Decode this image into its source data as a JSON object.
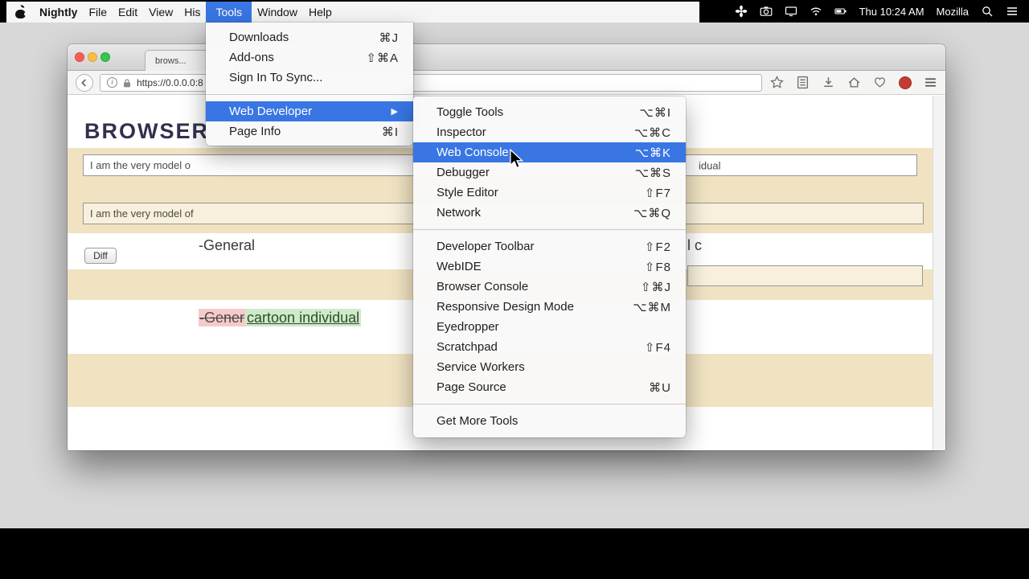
{
  "menubar": {
    "items": [
      "Nightly",
      "File",
      "Edit",
      "View",
      "His",
      "Tools",
      "Window",
      "Help"
    ],
    "selected_item": "Tools",
    "status": {
      "time": "Thu 10:24 AM",
      "label": "Mozilla"
    }
  },
  "tools_menu": {
    "submenu_arrow": "▶",
    "items": [
      {
        "label": "Downloads",
        "shortcut": "⌘J"
      },
      {
        "label": "Add-ons",
        "shortcut": "⇧⌘A"
      },
      {
        "label": "Sign In To Sync...",
        "shortcut": ""
      },
      {
        "separator": true
      },
      {
        "label": "Web Developer",
        "shortcut": "",
        "submenu": true,
        "highlighted": true
      },
      {
        "label": "Page Info",
        "shortcut": "⌘I"
      }
    ]
  },
  "webdev_menu": {
    "items": [
      {
        "label": "Toggle Tools",
        "shortcut": "⌥⌘I"
      },
      {
        "label": "Inspector",
        "shortcut": "⌥⌘C"
      },
      {
        "label": "Web Console",
        "shortcut": "⌥⌘K",
        "highlighted": true
      },
      {
        "label": "Debugger",
        "shortcut": "⌥⌘S"
      },
      {
        "label": "Style Editor",
        "shortcut": "⇧F7"
      },
      {
        "label": "Network",
        "shortcut": "⌥⌘Q"
      },
      {
        "separator": true
      },
      {
        "label": "Developer Toolbar",
        "shortcut": "⇧F2"
      },
      {
        "label": "WebIDE",
        "shortcut": "⇧F8"
      },
      {
        "label": "Browser Console",
        "shortcut": "⇧⌘J"
      },
      {
        "label": "Responsive Design Mode",
        "shortcut": "⌥⌘M"
      },
      {
        "label": "Eyedropper",
        "shortcut": ""
      },
      {
        "label": "Scratchpad",
        "shortcut": "⇧F4"
      },
      {
        "label": "Service Workers",
        "shortcut": ""
      },
      {
        "label": "Page Source",
        "shortcut": "⌘U"
      },
      {
        "separator": true
      },
      {
        "label": "Get More Tools",
        "shortcut": ""
      }
    ]
  },
  "browser": {
    "tab_title": "brows...",
    "url": "https://0.0.0.0:8",
    "page": {
      "heading": "BROWSER",
      "input1_text": "I am the very model o",
      "input1_tail": "idual",
      "input2_text": "I am the very model of",
      "diff_button": "Diff",
      "general_line": "-General",
      "right_fragment": "l c",
      "diff_removed": "-Gener",
      "diff_added": "cartoon individual"
    }
  },
  "colors": {
    "selection_blue": "#3976e4",
    "page_beige": "#f1e3c2",
    "diff_removed_bg": "#f6caca",
    "diff_added_bg": "#cfeac8",
    "traffic_red": "#fc5b57",
    "traffic_yellow": "#fdbe41",
    "traffic_green": "#34c84a"
  }
}
